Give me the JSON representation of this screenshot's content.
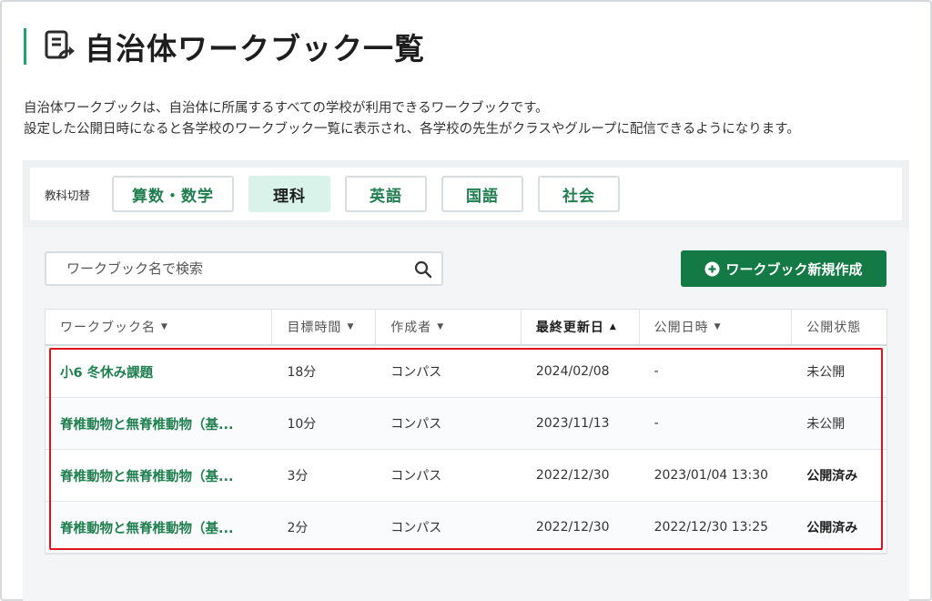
{
  "page": {
    "title": "自治体ワークブック一覧",
    "desc_line1": "自治体ワークブックは、自治体に所属するすべての学校が利用できるワークブックです。",
    "desc_line2": "設定した公開日時になると各学校のワークブック一覧に表示され、各学校の先生がクラスやグループに配信できるようになります。"
  },
  "subjects": {
    "label": "教科切替",
    "items": [
      {
        "label": "算数・数学",
        "active": false
      },
      {
        "label": "理科",
        "active": true
      },
      {
        "label": "英語",
        "active": false
      },
      {
        "label": "国語",
        "active": false
      },
      {
        "label": "社会",
        "active": false
      }
    ]
  },
  "search": {
    "placeholder": "ワークブック名で検索",
    "value": ""
  },
  "new_button": {
    "label": "ワークブック新規作成"
  },
  "table": {
    "headers": [
      {
        "label": "ワークブック名",
        "sort": "▼"
      },
      {
        "label": "目標時間",
        "sort": "▼"
      },
      {
        "label": "作成者",
        "sort": "▼"
      },
      {
        "label": "最終更新日",
        "sort": "▲"
      },
      {
        "label": "公開日時",
        "sort": "▼"
      },
      {
        "label": "公開状態",
        "sort": ""
      }
    ],
    "rows": [
      {
        "name": "小6 冬休み課題",
        "time": "18分",
        "author": "コンパス",
        "updated": "2024/02/08",
        "published_at": "-",
        "status": "未公開"
      },
      {
        "name": "脊椎動物と無脊椎動物（基...",
        "time": "10分",
        "author": "コンパス",
        "updated": "2023/11/13",
        "published_at": "-",
        "status": "未公開"
      },
      {
        "name": "脊椎動物と無脊椎動物（基...",
        "time": "3分",
        "author": "コンパス",
        "updated": "2022/12/30",
        "published_at": "2023/01/04 13:30",
        "status": "公開済み"
      },
      {
        "name": "脊椎動物と無脊椎動物（基...",
        "time": "2分",
        "author": "コンパス",
        "updated": "2022/12/30",
        "published_at": "2022/12/30 13:25",
        "status": "公開済み"
      }
    ]
  },
  "colors": {
    "accent": "#137a45",
    "link": "#1f7f4e",
    "highlight": "#e0121d",
    "active_subject": "#d9f3ea"
  },
  "icons": {
    "title": "workbook-share-icon",
    "search": "search-icon",
    "add": "plus-circle-icon"
  }
}
